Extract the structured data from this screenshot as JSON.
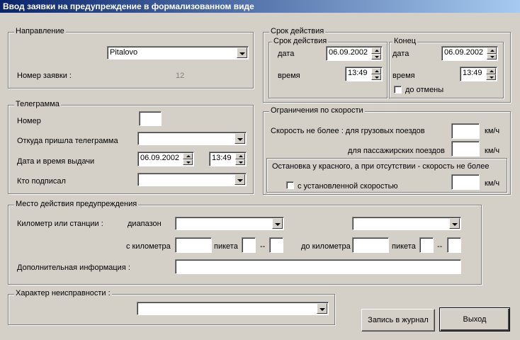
{
  "window": {
    "title": "Ввод заявки на предупреждение в формализованном виде"
  },
  "direction": {
    "legend": "Направление",
    "station_value": "Pitalovo",
    "request_no_label": "Номер  заявки :",
    "request_no_value": "12"
  },
  "validity": {
    "legend": "Срок действия",
    "start": {
      "legend": "Срок действия",
      "date_label": "дата",
      "date_value": "06.09.2002",
      "time_label": "время",
      "time_value": "13:49"
    },
    "end": {
      "legend": "Конец",
      "date_label": "дата",
      "date_value": "06.09.2002",
      "time_label": "время",
      "time_value": "13:49",
      "until_cancel_label": "до отмены"
    }
  },
  "telegram": {
    "legend": "Телеграмма",
    "number_label": "Номер",
    "number_value": "",
    "from_label": "Откуда пришла телеграмма",
    "from_value": "",
    "issued_label": "Дата и время выдачи",
    "issued_date": "06.09.2002",
    "issued_time": "13:49",
    "signed_label": "Кто подписал",
    "signed_value": ""
  },
  "speed": {
    "legend": "Ограничения по скорости",
    "freight_label": "Скорость не более :  для грузовых поездов",
    "passenger_label": "для пассажирских поездов",
    "unit": "км/ч",
    "stop_text": "Остановка у красного, а при отсутствии - скорость не более",
    "with_speed_label": "с установленной скоростью"
  },
  "place": {
    "legend": "Место действия предупреждения",
    "km_or_station_label": "Километр или станции :",
    "range_label": "диапазон",
    "from_km_label": "с километра",
    "picket_label": "пикета",
    "dash": "--",
    "to_km_label": "до километра",
    "extra_info_label": "Дополнительная информация :",
    "extra_info_value": ""
  },
  "fault": {
    "legend": "Характер неисправности :",
    "value": ""
  },
  "buttons": {
    "log": "Запись в журнал",
    "exit": "Выход"
  }
}
